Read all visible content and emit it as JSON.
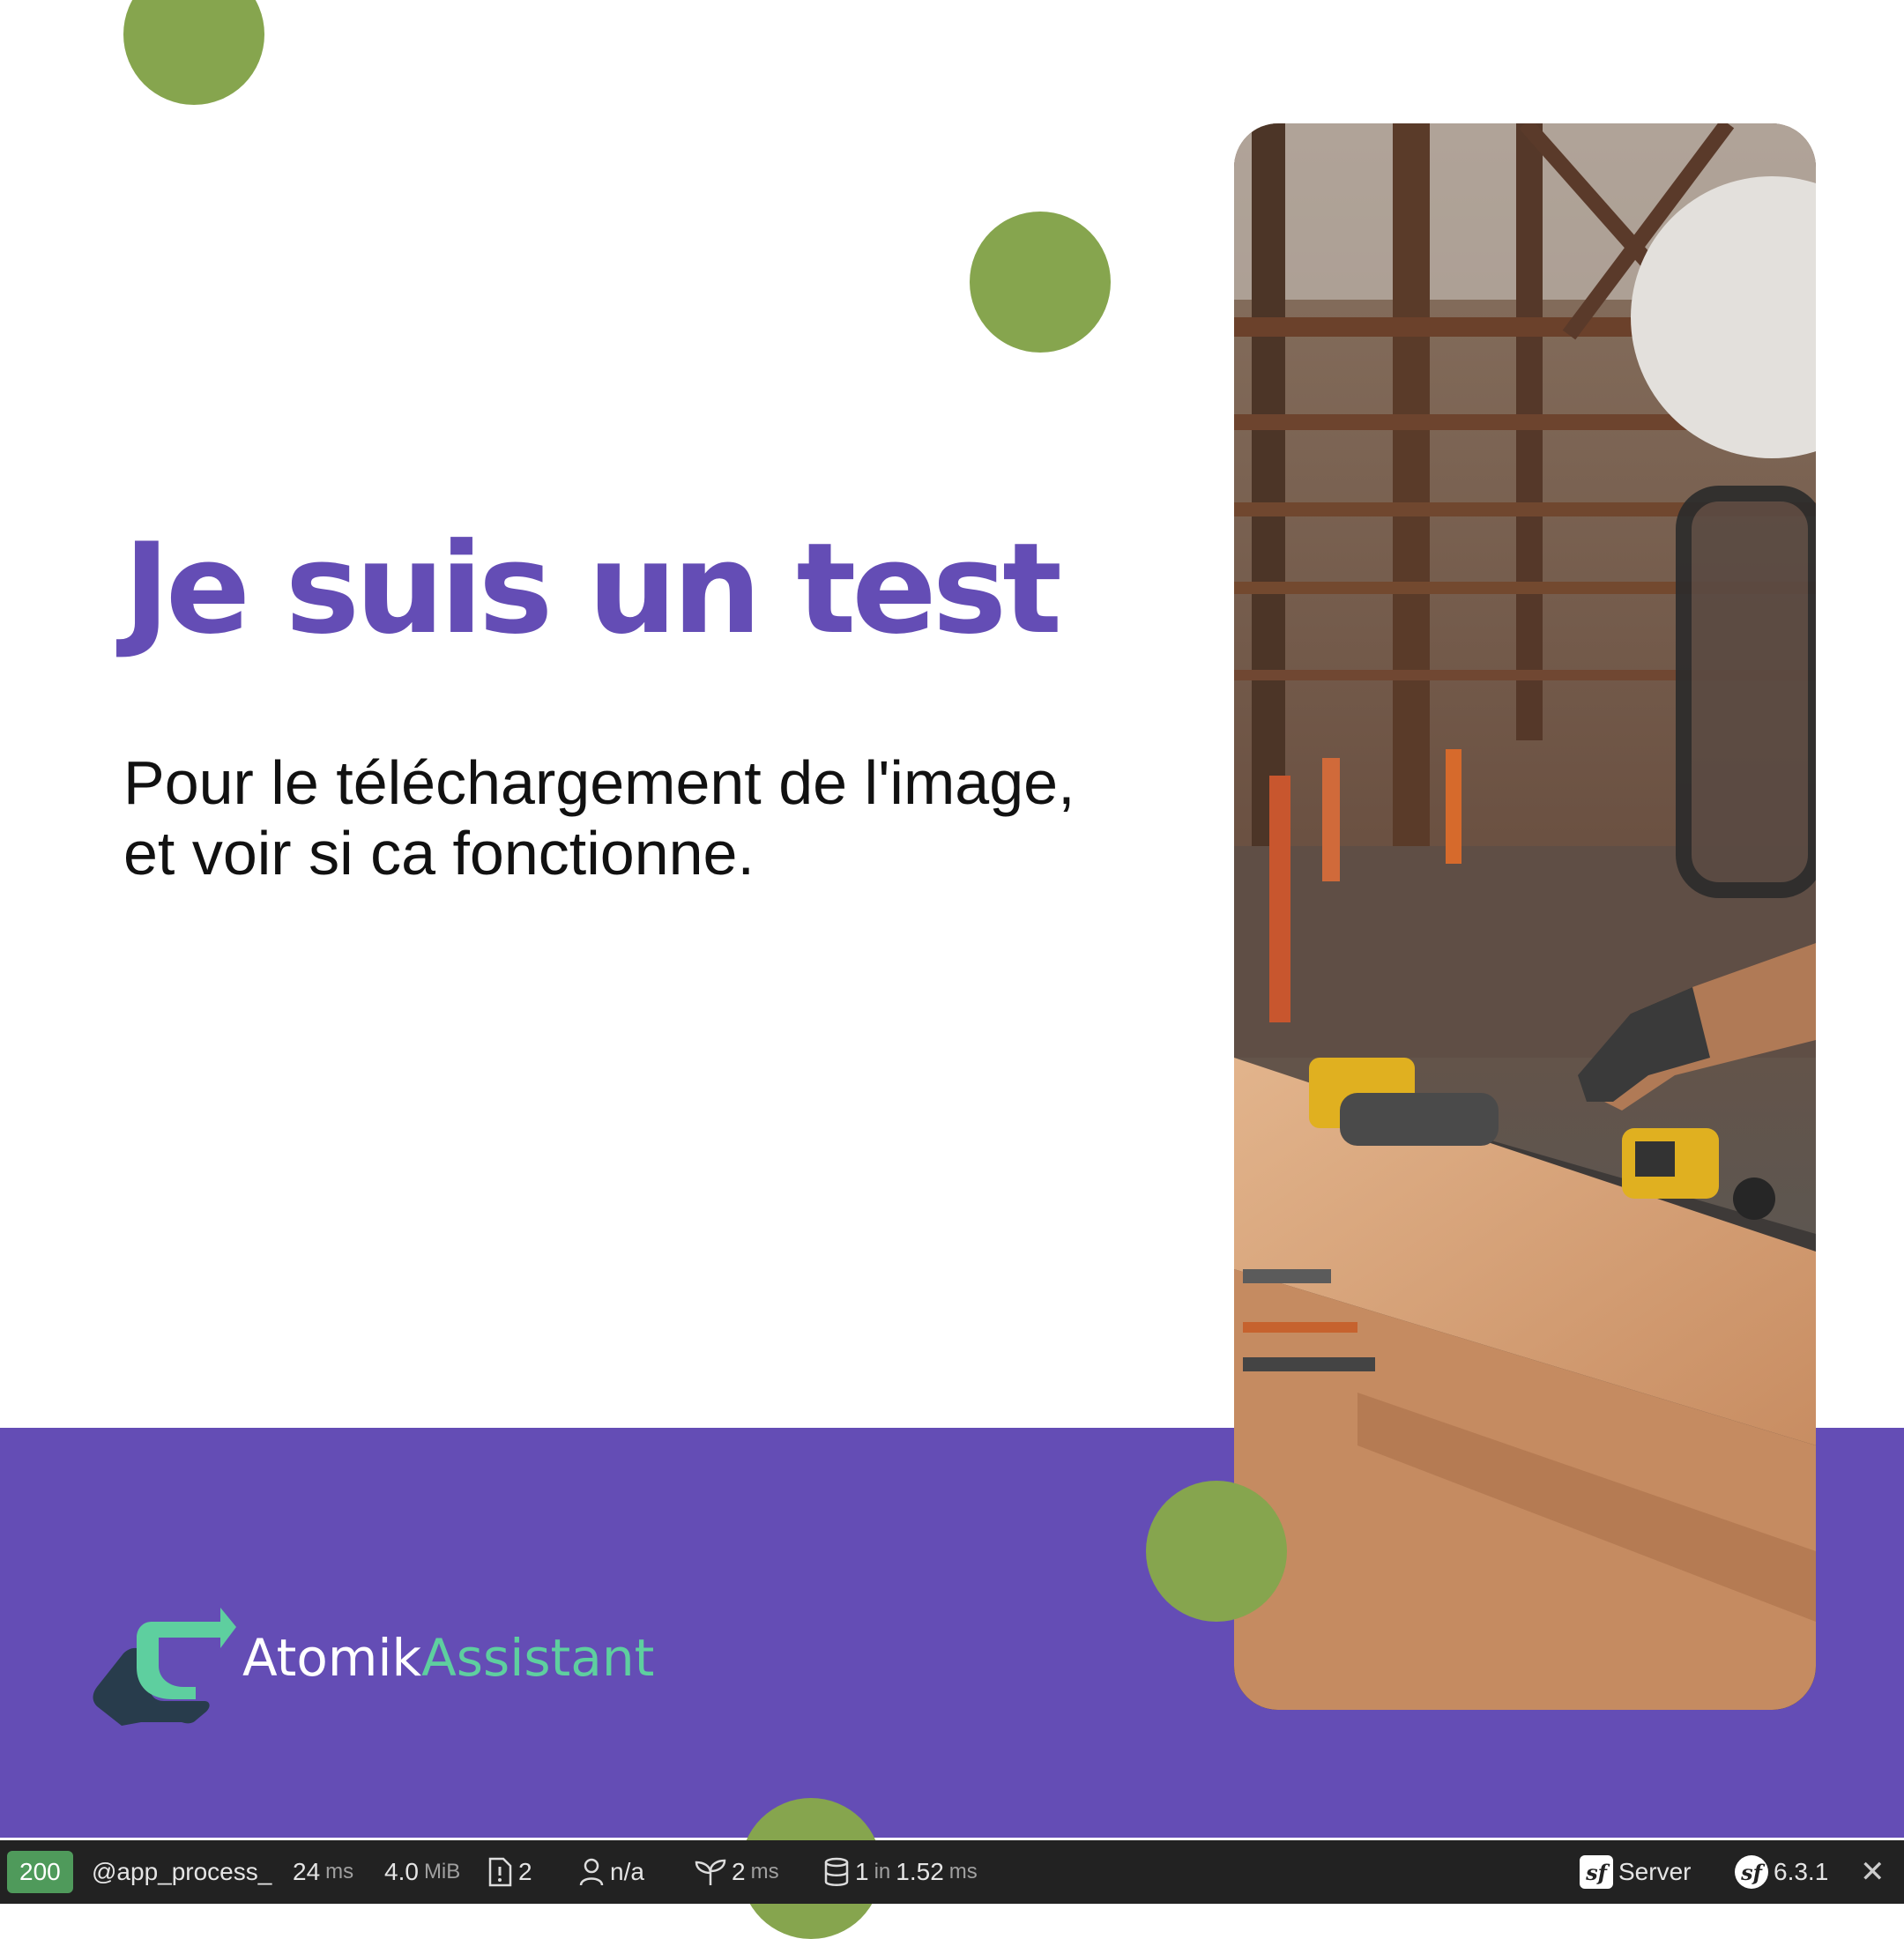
{
  "slide": {
    "title": "Je suis un test",
    "description_line1": "Pour le téléchargement de l'image,",
    "description_line2": "et voir si ca fonctionne.",
    "brand_part1": "Atomik",
    "brand_part2": "Assistant"
  },
  "colors": {
    "primary": "#644db5",
    "dot": "#86a54e",
    "brand_accent": "#5ecf9f",
    "brand_dark": "#283c4c"
  },
  "toolbar": {
    "status_code": "200",
    "route": "@app_process_",
    "time_value": "24",
    "time_unit": "ms",
    "memory_value": "4.0",
    "memory_unit": "MiB",
    "logs_count": "2",
    "user": "n/a",
    "twig_value": "2",
    "twig_unit": "ms",
    "db_queries": "1",
    "db_in": "in",
    "db_time": "1.52",
    "db_unit": "ms",
    "server_label": "Server",
    "symfony_version": "6.3.1",
    "icons": [
      "document-warning-icon",
      "user-icon",
      "leaf-icon",
      "database-icon",
      "symfony-icon",
      "close-icon"
    ]
  }
}
